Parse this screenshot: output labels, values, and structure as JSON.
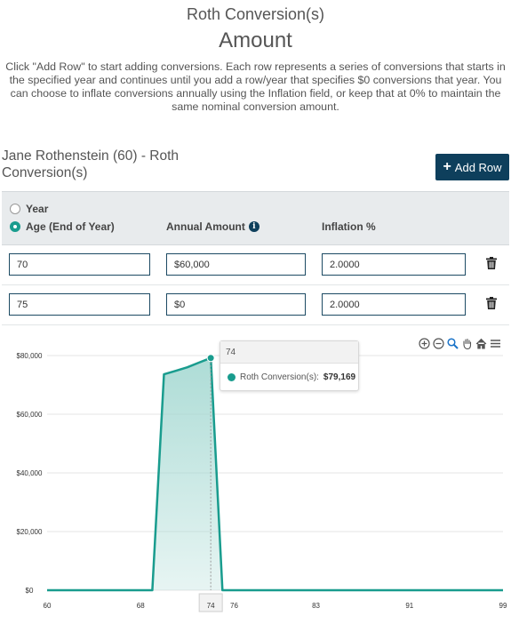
{
  "header": {
    "title": "Roth Conversion(s)",
    "subtitle": "Amount",
    "description": "Click \"Add Row\" to start adding conversions. Each row represents a series of conversions that starts in the specified year and continues until you add a row/year that specifies $0 conversions that year. You can choose to inflate conversions annually using the Inflation field, or keep that at 0% to maintain the same nominal conversion amount."
  },
  "section": {
    "title": "Jane Rothenstein (60) - Roth Conversion(s)",
    "add_row_label": "Add Row",
    "add_row_icon": "plus-icon"
  },
  "table": {
    "radio_options": [
      {
        "label": "Year",
        "checked": false
      },
      {
        "label": "Age (End of Year)",
        "checked": true
      }
    ],
    "columns": {
      "amount": "Annual Amount",
      "inflation": "Inflation %"
    },
    "rows": [
      {
        "age": "70",
        "amount": "$60,000",
        "inflation": "2.0000"
      },
      {
        "age": "75",
        "amount": "$0",
        "inflation": "2.0000"
      }
    ]
  },
  "toolbar_icons": [
    "zoom-in-icon",
    "zoom-out-icon",
    "magnifier-icon",
    "pan-hand-icon",
    "home-icon",
    "menu-icon"
  ],
  "tooltip": {
    "header": "74",
    "series": "Roth Conversion(s):",
    "value": "$79,169"
  },
  "colors": {
    "accent": "#199c8e",
    "button": "#0e3f5c",
    "area_fill": "#9fd6cf"
  },
  "chart_data": {
    "type": "area",
    "x": [
      60,
      69,
      70,
      71,
      72,
      73,
      74,
      75,
      99
    ],
    "series": [
      {
        "name": "Roth Conversion(s)",
        "values": [
          0,
          0,
          73600,
          74800,
          76000,
          77600,
          79169,
          0,
          0
        ]
      }
    ],
    "highlight_x": 74,
    "x_ticks": [
      "60",
      "68",
      "74",
      "76",
      "83",
      "91",
      "99"
    ],
    "y_ticks": [
      "$0",
      "$20,000",
      "$40,000",
      "$60,000",
      "$80,000"
    ],
    "xlim": [
      60,
      99
    ],
    "ylim": [
      0,
      80000
    ],
    "grid": true
  }
}
